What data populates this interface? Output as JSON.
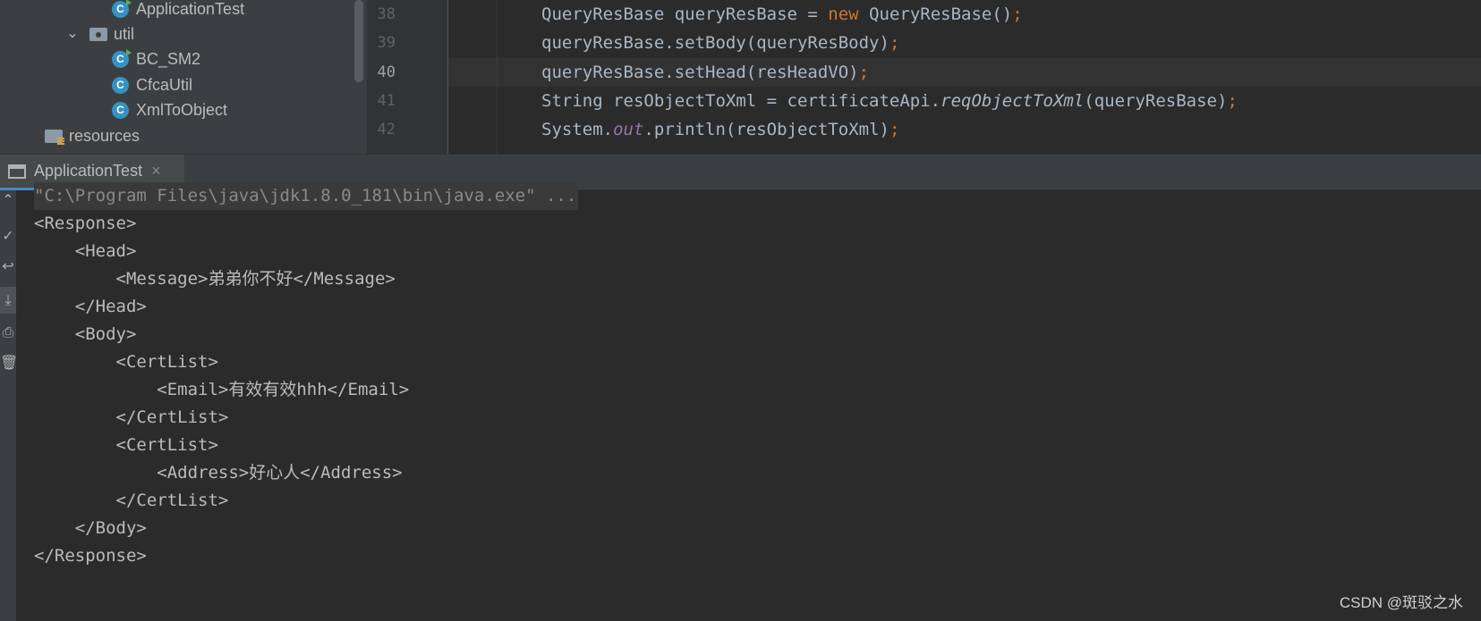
{
  "project_tree": {
    "items": [
      {
        "label": "ApplicationTest",
        "kind": "class-runnable"
      },
      {
        "label": "util",
        "kind": "package"
      },
      {
        "label": "BC_SM2",
        "kind": "class-runnable"
      },
      {
        "label": "CfcaUtil",
        "kind": "class"
      },
      {
        "label": "XmlToObject",
        "kind": "class"
      },
      {
        "label": "resources",
        "kind": "resources-folder"
      }
    ]
  },
  "editor": {
    "line_numbers": [
      "38",
      "39",
      "40",
      "41",
      "42"
    ],
    "current_line": "40",
    "lines": [
      {
        "a": "QueryResBase queryResBase = ",
        "kw": "new",
        "b": " QueryResBase()",
        "semi": ";"
      },
      {
        "a": "queryResBase.setBody(queryResBody)",
        "semi": ";"
      },
      {
        "a": "queryResBase.setHead(resHeadVO)",
        "semi": ";"
      },
      {
        "a": "String resObjectToXml = certificateApi.",
        "italic": "reqObjectToXml",
        "b": "(queryResBase)",
        "semi": ";"
      },
      {
        "a": "System.",
        "field": "out",
        "b": ".println(resObjectToXml)",
        "semi": ";"
      }
    ]
  },
  "run_window": {
    "tab_label": "ApplicationTest",
    "tab_close": "×"
  },
  "toolbar": {
    "icons": [
      "arrow-up-icon",
      "check-icon",
      "soft-wrap-icon",
      "scroll-to-end-icon",
      "print-icon",
      "trash-icon"
    ]
  },
  "console": {
    "lines": [
      "\"C:\\Program Files\\java\\jdk1.8.0_181\\bin\\java.exe\" ...",
      "<Response>",
      "    <Head>",
      "        <Message>弟弟你不好</Message>",
      "    </Head>",
      "    <Body>",
      "        <CertList>",
      "            <Email>有效有效hhh</Email>",
      "        </CertList>",
      "        <CertList>",
      "            <Address>好心人</Address>",
      "        </CertList>",
      "    </Body>",
      "</Response>"
    ]
  },
  "watermark": "CSDN @斑驳之水",
  "colors": {
    "keyword": "#cc7832",
    "static_field": "#9876aa",
    "tab_underline": "#4a88c7"
  }
}
